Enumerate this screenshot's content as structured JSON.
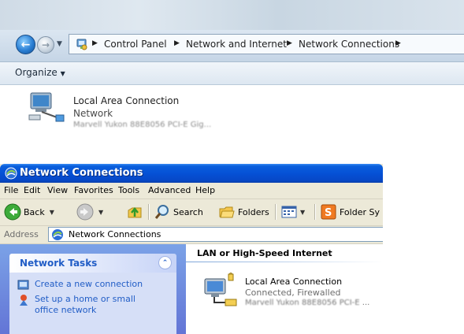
{
  "vista": {
    "breadcrumb": [
      "Control Panel",
      "Network and Internet",
      "Network Connections"
    ],
    "command_bar": {
      "organize_label": "Organize"
    },
    "connection": {
      "name": "Local Area Connection",
      "status": "Network",
      "device": "Marvell Yukon 88E8056 PCI-E Gig..."
    }
  },
  "xp": {
    "title": "Network Connections",
    "menu": [
      "File",
      "Edit",
      "View",
      "Favorites",
      "Tools",
      "Advanced",
      "Help"
    ],
    "toolbar": {
      "back_label": "Back",
      "search_label": "Search",
      "folders_label": "Folders",
      "folder_sync_label": "Folder Sy"
    },
    "address": {
      "label": "Address",
      "value": "Network Connections"
    },
    "task_panel": {
      "title": "Network Tasks",
      "tasks": [
        "Create a new connection",
        "Set up a home or small",
        "office network"
      ]
    },
    "group_header": "LAN or High-Speed Internet",
    "connection": {
      "name": "Local Area Connection",
      "status": "Connected, Firewalled",
      "device": "Marvell Yukon 88E8056 PCI-E",
      "device_suffix": " ..."
    }
  },
  "colors": {
    "xp_title": "#0551d6",
    "xp_task_link": "#215dc6",
    "xp_sidebar": "#7ba2e7",
    "vista_bar": "#c5d5e6"
  }
}
